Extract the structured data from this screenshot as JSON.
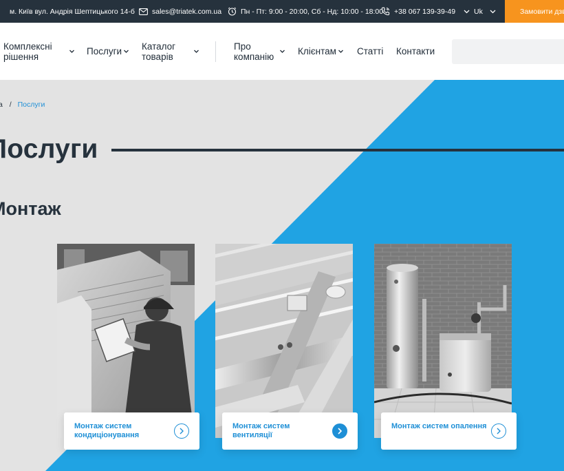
{
  "topbar": {
    "address": "м. Київ вул. Андрія Шептицького 14-б",
    "email": "sales@triatek.com.ua",
    "hours": "Пн - Пт: 9:00 - 20:00, Сб - Нд: 10:00 - 18:00",
    "phone": "+38 067 139-39-49",
    "language": "Uk",
    "order_button": "Замовити дзвінок"
  },
  "nav": {
    "complex_line1": "Комплексні",
    "complex_line2": "рішення",
    "services": "Послуги",
    "catalog_line1": "Каталог",
    "catalog_line2": "товарів",
    "about_line1": "Про",
    "about_line2": "компанію",
    "clients": "Клієнтам",
    "articles": "Статті",
    "contacts": "Контакти"
  },
  "breadcrumb": {
    "home": "а",
    "separator": "/",
    "current": "Послуги"
  },
  "page": {
    "title": "Послуги",
    "section_title": "Монтаж"
  },
  "cards": [
    {
      "label": "Монтаж систем кондиціонування",
      "image": "air-conditioner-installer-photo"
    },
    {
      "label": "Монтаж систем вентиляції",
      "image": "ventilation-ducts-photo"
    },
    {
      "label": "Монтаж систем опалення",
      "image": "boiler-room-photo"
    }
  ],
  "colors": {
    "dark": "#26323d",
    "accent_orange": "#f7941e",
    "accent_blue": "#1e8fd6",
    "hero_blue": "#20a3e3",
    "hero_gray": "#e3e3e3"
  }
}
